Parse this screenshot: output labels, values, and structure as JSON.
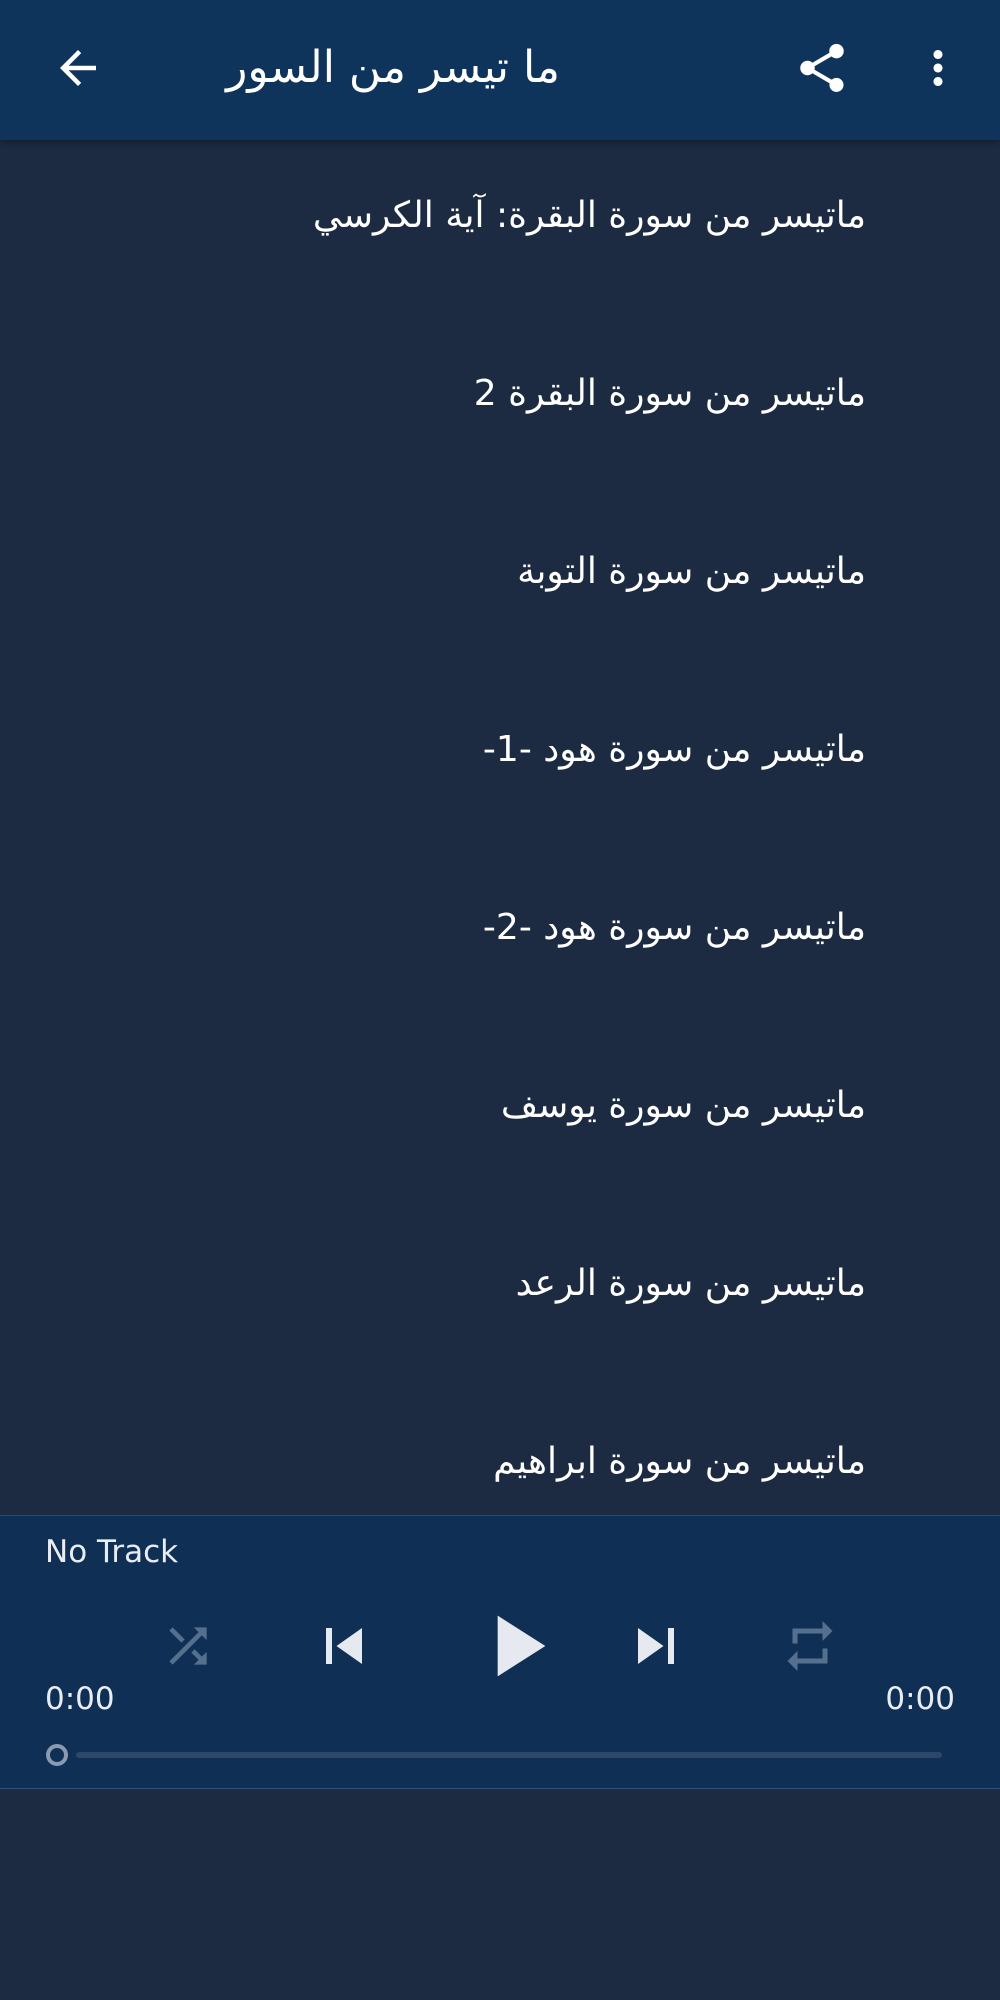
{
  "app_bar": {
    "title": "ما تيسر من السور",
    "back_icon": "arrow-back-icon",
    "share_icon": "share-icon",
    "more_icon": "more-vert-icon"
  },
  "list": {
    "items": [
      {
        "label": "ماتيسر من سورة البقرة: آية الكرسي"
      },
      {
        "label": "ماتيسر من سورة البقرة 2"
      },
      {
        "label": "ماتيسر من سورة التوبة"
      },
      {
        "label": "ماتيسر من سورة هود -1-"
      },
      {
        "label": "ماتيسر من سورة هود -2-"
      },
      {
        "label": "ماتيسر من سورة يوسف"
      },
      {
        "label": "ماتيسر من سورة الرعد"
      },
      {
        "label": "ماتيسر من سورة ابراهيم"
      }
    ]
  },
  "player": {
    "track_name": "No Track",
    "elapsed": "0:00",
    "duration": "0:00",
    "progress": 0,
    "controls": {
      "shuffle_icon": "shuffle-icon",
      "previous_icon": "skip-previous-icon",
      "play_icon": "play-icon",
      "next_icon": "skip-next-icon",
      "repeat_icon": "repeat-icon"
    }
  },
  "colors": {
    "app_bar": "#0f345c",
    "background": "#1c2a42",
    "player_bar": "#0f2f55",
    "active_control": "#e6eaf0",
    "inactive_control": "#55708f"
  }
}
